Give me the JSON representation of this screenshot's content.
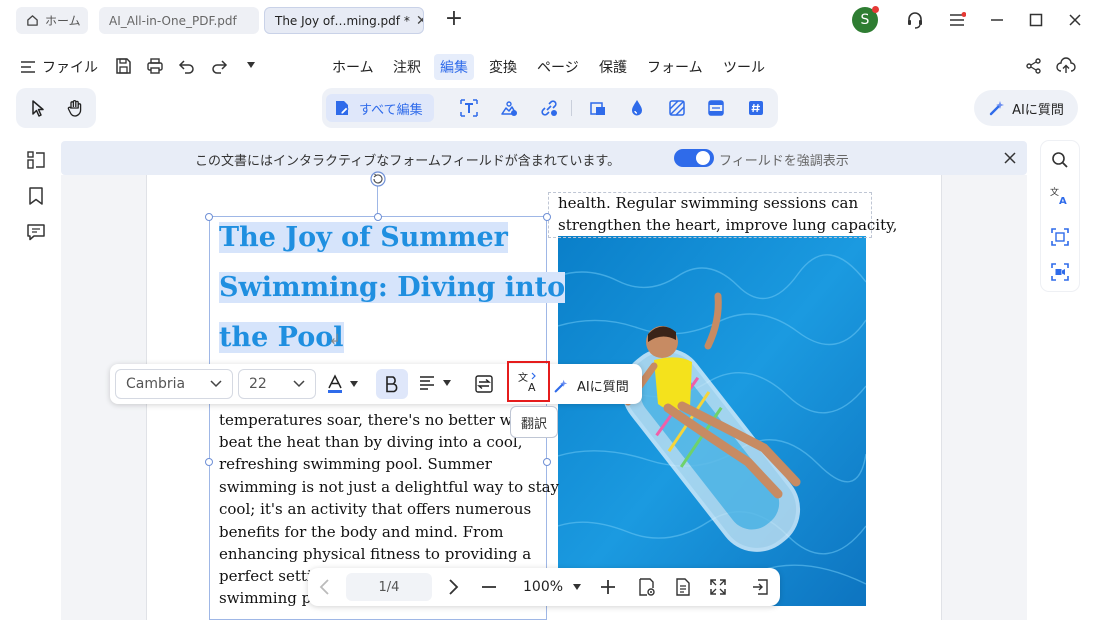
{
  "tabs": {
    "home_label": "ホーム",
    "file1_label": "AI_All-in-One_PDF.pdf",
    "file2_label": "The Joy of…ming.pdf *",
    "close_glyph": "✕",
    "new_tab_glyph": "+"
  },
  "user": {
    "avatar_letter": "S"
  },
  "menubar": {
    "file_label": "ファイル",
    "tabs": [
      "ホーム",
      "注釈",
      "編集",
      "変換",
      "ページ",
      "保護",
      "フォーム",
      "ツール"
    ],
    "active_tab": "編集"
  },
  "edit_toolbar": {
    "edit_all_label": "すべて編集",
    "ai_label": "AIに質問"
  },
  "notice": {
    "message": "この文書にはインタラクティブなフォームフィールドが含まれています。",
    "toggle_label": "フィールドを強調表示",
    "toggle_on": true
  },
  "document": {
    "title_lines": [
      "The Joy of Summer ",
      "Swimming: Diving into",
      "the Pool"
    ],
    "return_glyph": "↲",
    "body_lines": [
      "temperatures soar, there's no better way to",
      "beat the heat than by diving into a cool,",
      "refreshing swimming pool. Summer",
      "swimming is not just a delightful way to stay",
      "cool; it's an activity that offers numerous",
      "benefits for the body and mind. From",
      "enhancing physical fitness to providing a",
      "perfect setting",
      "swimming po"
    ],
    "right_lines": [
      "health. Regular swimming sessions can",
      "strengthen the heart, improve lung capacity,"
    ]
  },
  "float_toolbar": {
    "font": "Cambria",
    "size": "22",
    "ai_label": "AIに質問",
    "tooltip": "翻訳"
  },
  "bottom_nav": {
    "page": "1/4",
    "zoom": "100%"
  },
  "colors": {
    "accent": "#2f6bea",
    "title_blue": "#1f8fe0",
    "highlight_red": "#e51c1c"
  }
}
